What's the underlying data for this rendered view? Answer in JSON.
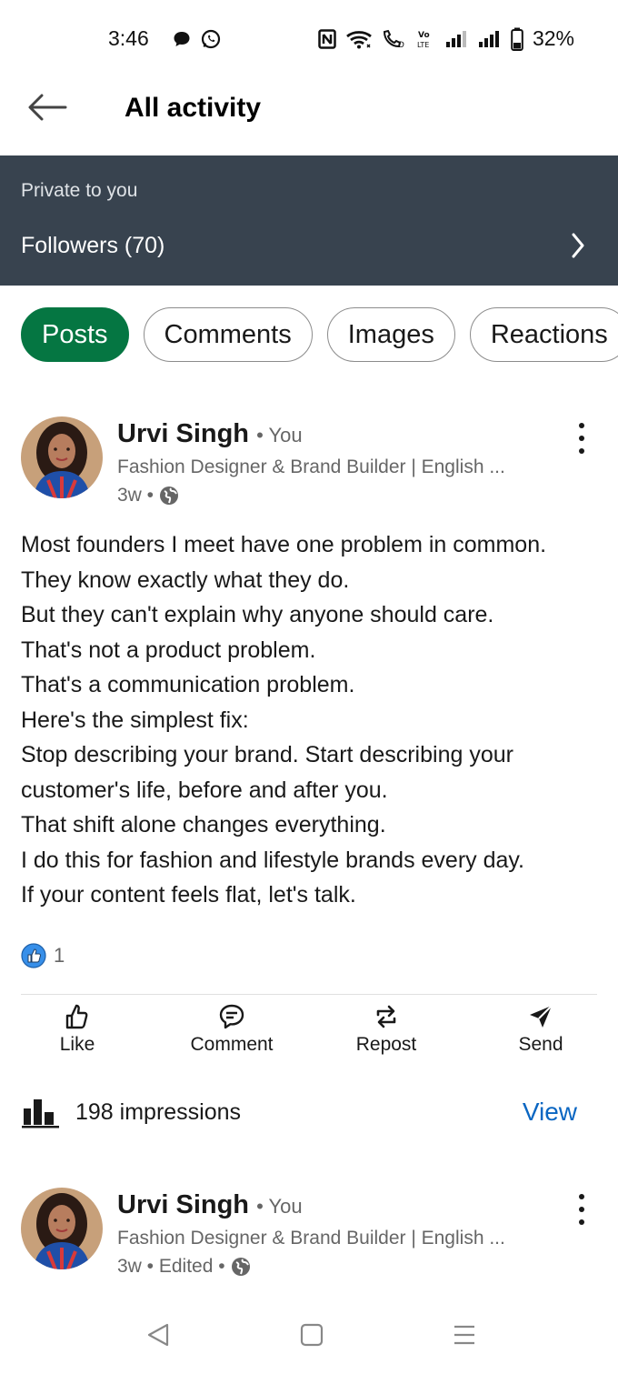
{
  "status_bar": {
    "time": "3:46",
    "battery": "32%",
    "network_label": "Vo LTE"
  },
  "header": {
    "title": "All activity"
  },
  "private_banner": {
    "label": "Private to you",
    "followers": "Followers (70)"
  },
  "tabs": [
    {
      "label": "Posts",
      "active": true
    },
    {
      "label": "Comments",
      "active": false
    },
    {
      "label": "Images",
      "active": false
    },
    {
      "label": "Reactions",
      "active": false
    }
  ],
  "posts": [
    {
      "author": "Urvi Singh",
      "you_badge": "• You",
      "headline": "Fashion Designer & Brand Builder | English ...",
      "time": "3w •",
      "lines": [
        "Most founders I meet have one problem in common.",
        "They know exactly what they do.",
        "But they can't explain why anyone should care.",
        "That's not a product problem.",
        "That's a communication problem.",
        "Here's the simplest fix:",
        "Stop describing your brand. Start describing your",
        "customer's life, before and after you.",
        "That shift alone changes everything.",
        "I do this for fashion and lifestyle brands every day.",
        "If your content feels flat, let's talk."
      ],
      "reaction_count": "1",
      "actions": {
        "like": "Like",
        "comment": "Comment",
        "repost": "Repost",
        "send": "Send"
      },
      "impressions": "198 impressions",
      "view_label": "View"
    },
    {
      "author": "Urvi Singh",
      "you_badge": "• You",
      "headline": "Fashion Designer & Brand Builder | English ...",
      "time": "3w • Edited •"
    }
  ],
  "colors": {
    "banner_bg": "#38434f",
    "active_tab": "#057642",
    "link_blue": "#0a66c2",
    "reaction_blue": "#378fe9"
  }
}
